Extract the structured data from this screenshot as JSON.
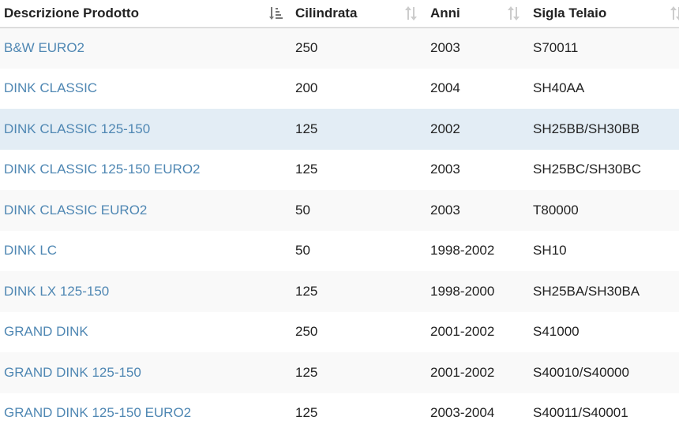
{
  "table": {
    "headers": [
      {
        "label": "Descrizione Prodotto",
        "sort": "asc"
      },
      {
        "label": "Cilindrata",
        "sort": "none"
      },
      {
        "label": "Anni",
        "sort": "none"
      },
      {
        "label": "Sigla Telaio",
        "sort": "none"
      }
    ],
    "rows": [
      {
        "product": "B&W EURO2",
        "cc": "250",
        "years": "2003",
        "frame": "S70011"
      },
      {
        "product": "DINK CLASSIC",
        "cc": "200",
        "years": "2004",
        "frame": "SH40AA"
      },
      {
        "product": "DINK CLASSIC 125-150",
        "cc": "125",
        "years": "2002",
        "frame": "SH25BB/SH30BB"
      },
      {
        "product": "DINK CLASSIC 125-150 EURO2",
        "cc": "125",
        "years": "2003",
        "frame": "SH25BC/SH30BC"
      },
      {
        "product": "DINK CLASSIC EURO2",
        "cc": "50",
        "years": "2003",
        "frame": "T80000"
      },
      {
        "product": "DINK LC",
        "cc": "50",
        "years": "1998-2002",
        "frame": "SH10"
      },
      {
        "product": "DINK LX 125-150",
        "cc": "125",
        "years": "1998-2000",
        "frame": "SH25BA/SH30BA"
      },
      {
        "product": "GRAND DINK",
        "cc": "250",
        "years": "2001-2002",
        "frame": "S41000"
      },
      {
        "product": "GRAND DINK 125-150",
        "cc": "125",
        "years": "2001-2002",
        "frame": "S40010/S40000"
      },
      {
        "product": "GRAND DINK 125-150 EURO2",
        "cc": "125",
        "years": "2003-2004",
        "frame": "S40011/S40001"
      }
    ],
    "highlighted_row": 2
  },
  "colors": {
    "link": "#4f87b3",
    "text": "#222222",
    "row_odd": "#f9f9f9",
    "row_highlight": "#e3edf5",
    "sort_icon_active": "#777777",
    "sort_icon_inactive": "#cccccc"
  }
}
